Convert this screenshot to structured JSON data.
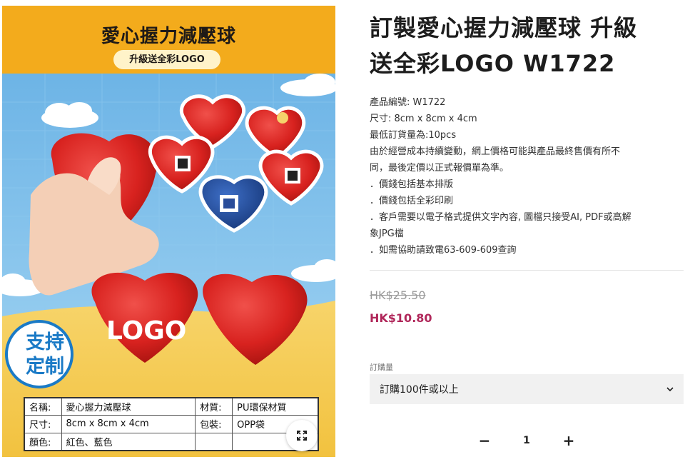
{
  "image": {
    "banner_title": "愛心握力減壓球",
    "banner_subtitle": "升級送全彩LOGO",
    "logo_text": "LOGO",
    "badge_line1": "支持",
    "badge_line2": "定制",
    "spec_table": {
      "rows": [
        {
          "k1": "名稱:",
          "v1": "愛心握力減壓球",
          "k2": "材質:",
          "v2": "PU環保材質"
        },
        {
          "k1": "尺寸:",
          "v1": "8cm x 8cm x 4cm",
          "k2": "包裝:",
          "v2": "OPP袋"
        },
        {
          "k1": "顏色:",
          "v1": "紅色、藍色",
          "k2": "",
          "v2": ""
        }
      ]
    },
    "expand_icon": "expand-icon"
  },
  "product": {
    "title_line1": "訂製愛心握力減壓球 升級",
    "title_line2": "送全彩LOGO W1722",
    "description": [
      "產品編號: W1722",
      "尺寸: 8cm x 8cm x 4cm",
      "最低訂貨量為:10pcs",
      "由於經營成本持續變動，網上價格可能與產品最終售價有所不",
      "同，最後定價以正式報價單為準。",
      "．價錢包括基本排版",
      "．價錢包括全彩印刷",
      "．客戶需要以電子格式提供文字內容, 圖檔只接受AI, PDF或高解",
      "象JPG檔",
      "．如需協助請致電63-609-609查詢"
    ],
    "price_original": "HK$25.50",
    "price_sale": "HK$10.80",
    "quantity_label": "訂購量",
    "quantity_option": "訂購100件或以上",
    "quantity_value": "1",
    "minus_label": "−",
    "plus_label": "+"
  },
  "colors": {
    "banner": "#f3ab1c",
    "sale_price": "#b0275a",
    "heart_red": "#d8221f",
    "heart_blue": "#1f4fa3",
    "sky": "#7cbfe9"
  }
}
